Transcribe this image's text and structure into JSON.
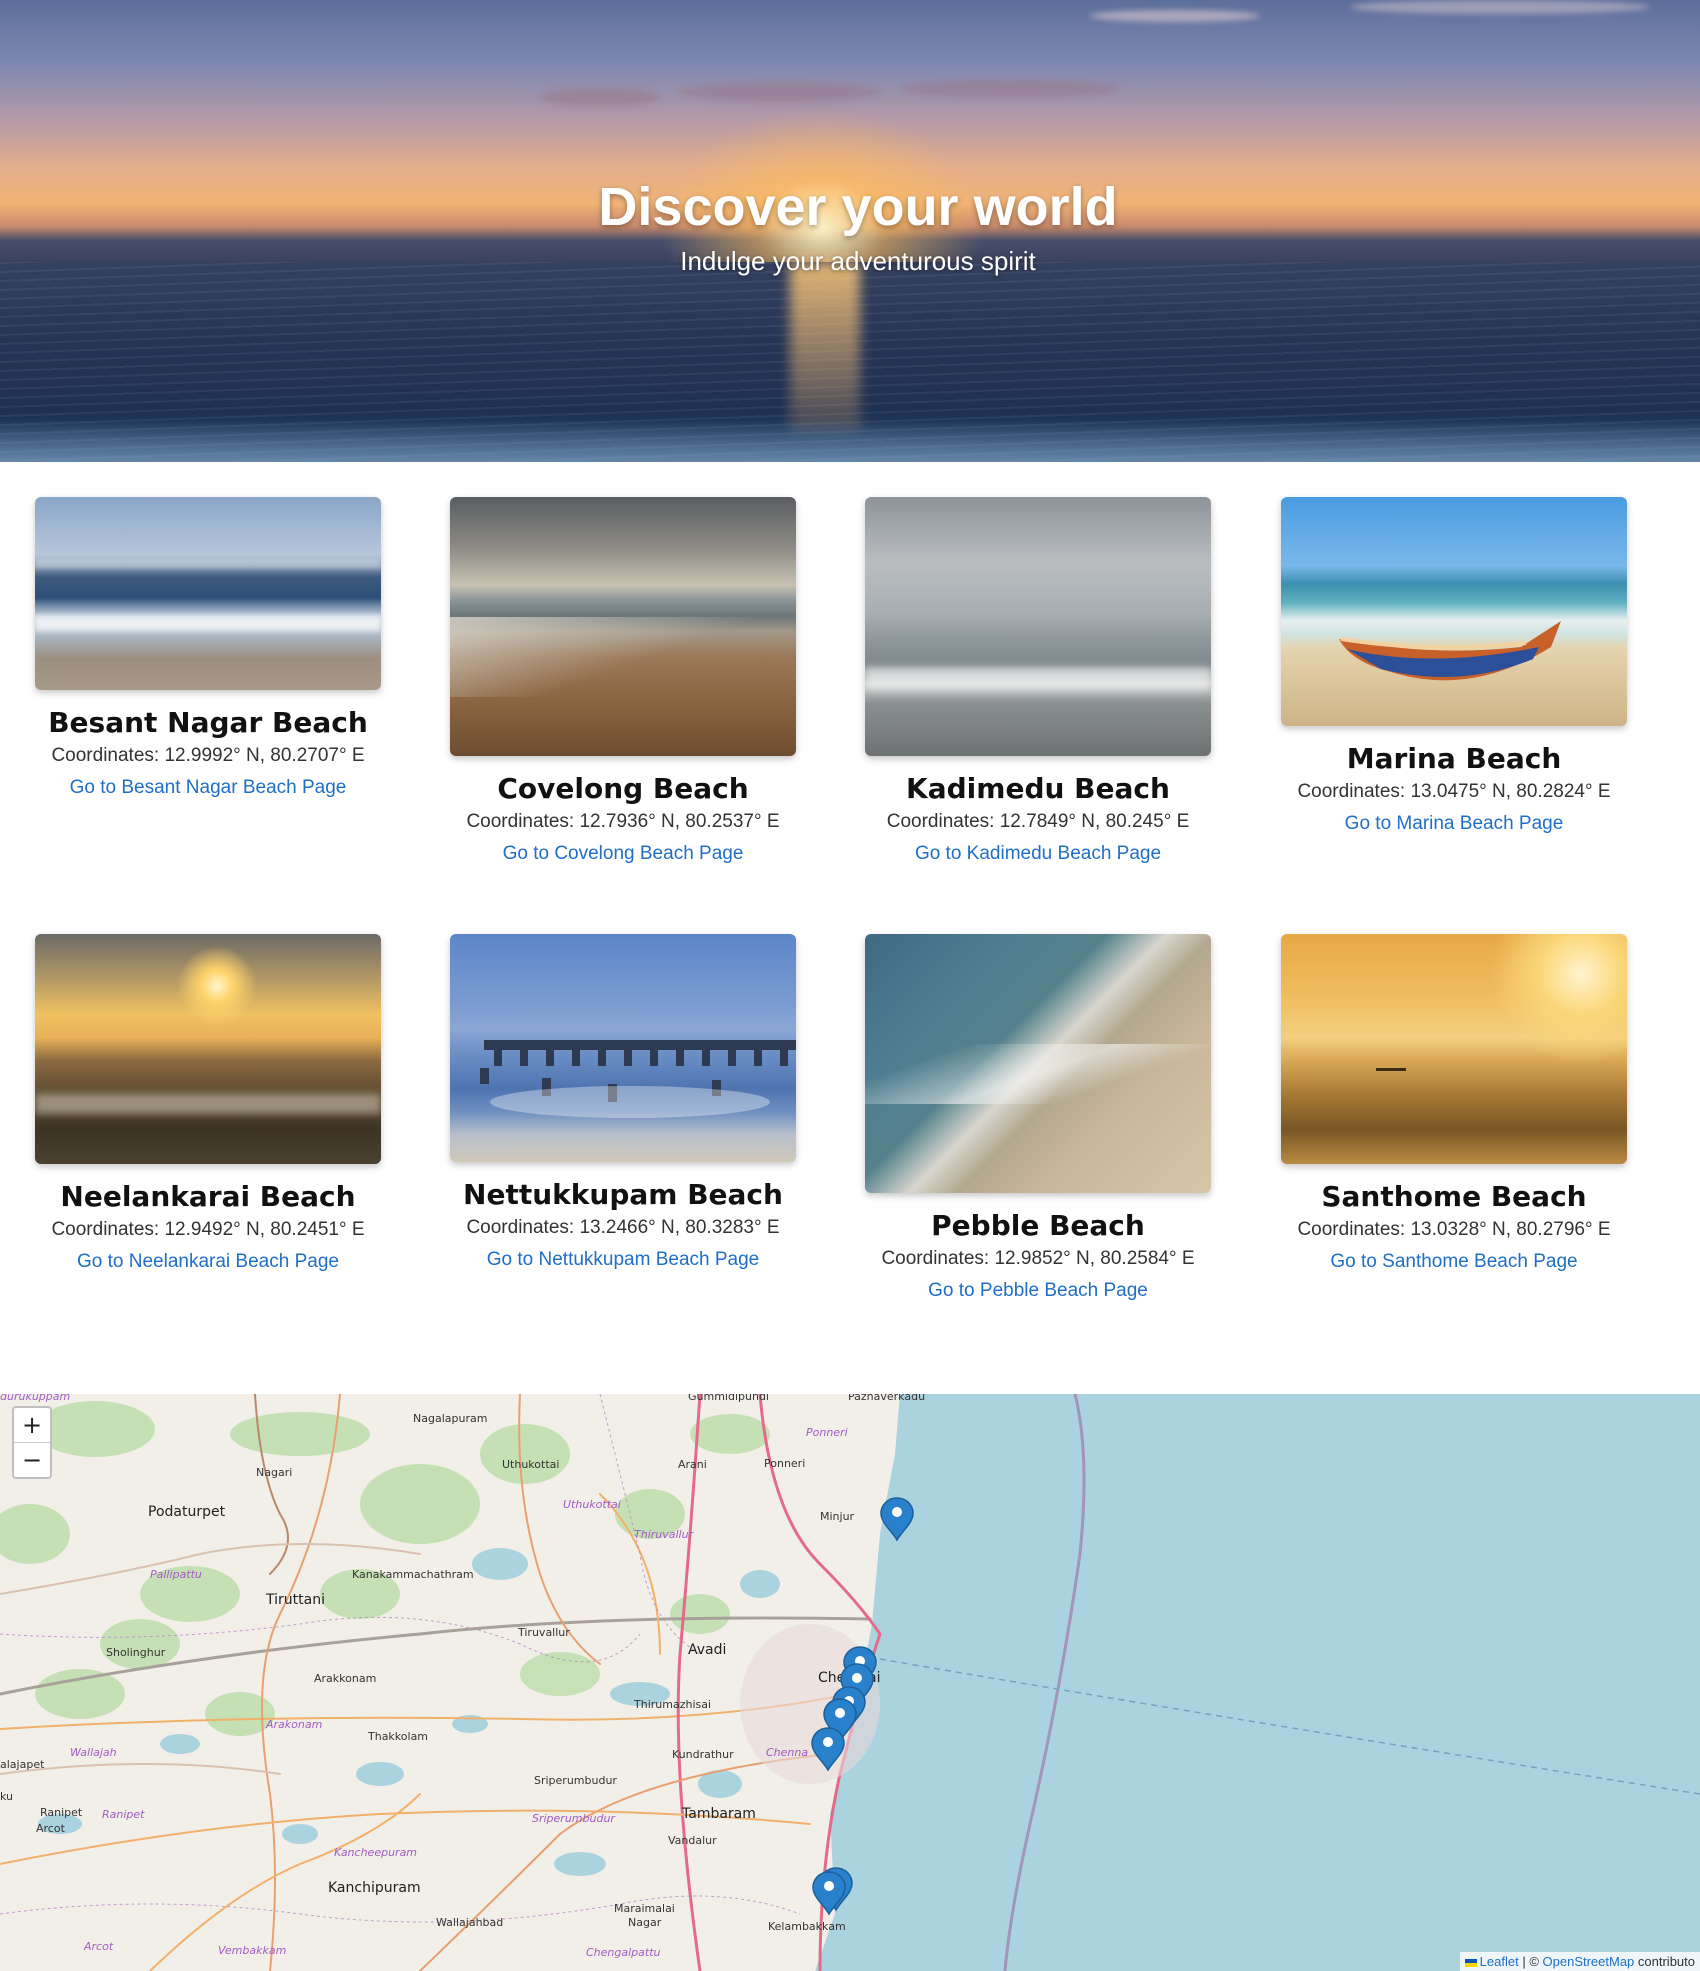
{
  "hero": {
    "title": "Discover your world",
    "subtitle": "Indulge your adventurous spirit"
  },
  "beaches": [
    {
      "name": "Besant Nagar Beach",
      "coords": "Coordinates: 12.9992° N, 80.2707° E",
      "link": "Go to Besant Nagar Beach Page"
    },
    {
      "name": "Covelong Beach",
      "coords": "Coordinates: 12.7936° N, 80.2537° E",
      "link": "Go to Covelong Beach Page"
    },
    {
      "name": "Kadimedu Beach",
      "coords": "Coordinates: 12.7849° N, 80.245° E",
      "link": "Go to Kadimedu Beach Page"
    },
    {
      "name": "Marina Beach",
      "coords": "Coordinates: 13.0475° N, 80.2824° E",
      "link": "Go to Marina Beach Page"
    },
    {
      "name": "Neelankarai Beach",
      "coords": "Coordinates: 12.9492° N, 80.2451° E",
      "link": "Go to Neelankarai Beach Page"
    },
    {
      "name": "Nettukkupam Beach",
      "coords": "Coordinates: 13.2466° N, 80.3283° E",
      "link": "Go to Nettukkupam Beach Page"
    },
    {
      "name": "Pebble Beach",
      "coords": "Coordinates: 12.9852° N, 80.2584° E",
      "link": "Go to Pebble Beach Page"
    },
    {
      "name": "Santhome Beach",
      "coords": "Coordinates: 13.0328° N, 80.2796° E",
      "link": "Go to Santhome Beach Page"
    }
  ],
  "map": {
    "zoom_in": "+",
    "zoom_out": "−",
    "attribution": {
      "leaflet": "Leaflet",
      "separator": " | © ",
      "osm": "OpenStreetMap",
      "suffix": " contributo"
    },
    "towns": {
      "nagalapuram": "Nagalapuram",
      "nagari": "Nagari",
      "uthukottai": "Uthukottai",
      "arani": "Arani",
      "ponneri": "Ponneri",
      "ponneri_taluk": "Ponneri",
      "minjur": "Minjur",
      "podaturpet": "Podaturpet",
      "pallipattu": "Pallipattu",
      "uthukottai_taluk": "Uthukottai",
      "thiruvallur_taluk": "Thiruvallur",
      "kanakammachathram": "Kanakammachathram",
      "tiruttani": "Tiruttani",
      "sholinghur": "Sholinghur",
      "tiruvallur": "Tiruvallur",
      "avadi": "Avadi",
      "chennai": "Che",
      "chennai2": "ai",
      "arakkonam": "Arakkonam",
      "arakonam_taluk": "Arakonam",
      "thirumazhisai": "Thirumazhisai",
      "wallajah": "Wallajah",
      "thakkolam": "Thakkolam",
      "kundrathur": "Kundrathur",
      "chennai_taluk": "Chenna",
      "walajapet": "alajapet",
      "sriperumbudur": "Sriperumbudur",
      "ranipet": "Ranipet",
      "ranipet_taluk": "Ranipet",
      "arcot": "Arcot",
      "sriperumbudur_taluk": "Sriperumbudur",
      "tambaram": "Tambaram",
      "vandalur": "Vandalur",
      "kancheepuram_taluk": "Kancheepuram",
      "kanchipuram": "Kanchipuram",
      "wallajahbad": "Wallajahbad",
      "maraimalai": "Maraimalai",
      "nagar": "Nagar",
      "kelambakkam": "Kelambakkam",
      "arcot2": "Arcot",
      "vembakkam": "Vembakkam",
      "chengalpattu": "Chengalpattu",
      "gurukuppam": "durukuppam",
      "gummidipundi": "Gummidipundi",
      "pazhaverkadu": "Pazhaverkadu",
      "ku": "ku"
    },
    "markers_count": 8
  },
  "colors": {
    "link": "#1f6fc8",
    "sea": "#aad3df",
    "marker": "#2a81cb"
  }
}
